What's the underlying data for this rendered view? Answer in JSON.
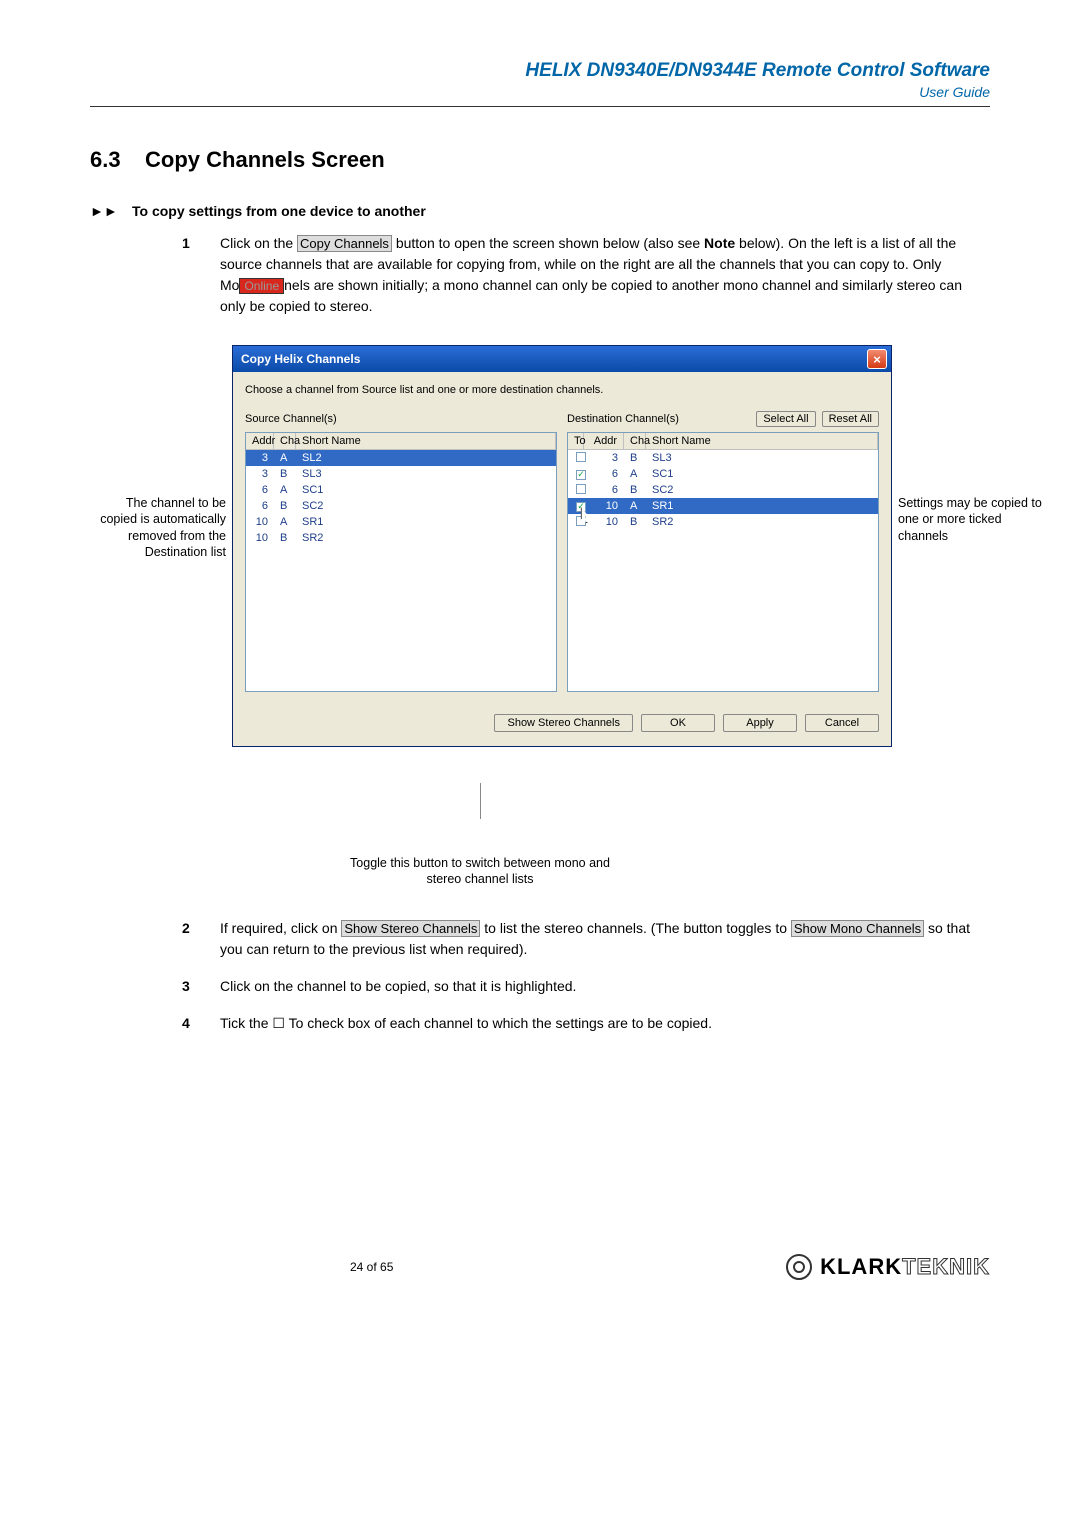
{
  "header": {
    "title": "HELIX DN9340E/DN9344E Remote Control Software",
    "subtitle": "User Guide"
  },
  "section": {
    "number": "6.3",
    "title": "Copy Channels Screen"
  },
  "instruction": {
    "heading": "To copy settings from one device to another"
  },
  "steps": {
    "s1": {
      "num": "1",
      "t1": "Click on the ",
      "btn1": "Copy Channels",
      "t2": " button to open the screen shown below (also see ",
      "bold1": "Note",
      "t3": " below). On the left is a list of all the source channels that are available for copying from, while on the right are all the channels that you can copy to.  Only Mo",
      "online": "Online",
      "t4": "nels are shown initially; a mono channel can only be copied to another mono channel and similarly stereo can only be copied to stereo."
    },
    "s2": {
      "num": "2",
      "t1": "If required, click on ",
      "btn1": "Show Stereo Channels",
      "t2": " to list the stereo channels.  (The button toggles to ",
      "btn2": "Show Mono Channels",
      "t3": " so that you can return to the previous list when required)."
    },
    "s3": {
      "num": "3",
      "text": "Click on the channel to be copied, so that it is highlighted."
    },
    "s4": {
      "num": "4",
      "t1": "Tick the ",
      "cb": "☐ To",
      "t2": " check box of each channel to which the settings are to be copied."
    }
  },
  "annot_left": "The channel to be copied is automatically removed from the Destination list",
  "annot_right": "Settings may be copied to one or more ticked channels",
  "annot_below": "Toggle this button to switch between mono and stereo channel lists",
  "dialog": {
    "title": "Copy Helix Channels",
    "hint": "Choose a channel from Source list and one or more destination channels.",
    "src_label": "Source Channel(s)",
    "dst_label": "Destination Channel(s)",
    "select_all": "Select All",
    "reset_all": "Reset All",
    "src_head": {
      "addr": "Addr",
      "cha": "Cha",
      "short": "Short Name"
    },
    "dst_head": {
      "to": "To",
      "addr": "Addr",
      "cha": "Cha",
      "short": "Short Name"
    },
    "src_rows": [
      {
        "addr": "3",
        "cha": "A",
        "short": "SL2",
        "sel": true
      },
      {
        "addr": "3",
        "cha": "B",
        "short": "SL3"
      },
      {
        "addr": "6",
        "cha": "A",
        "short": "SC1"
      },
      {
        "addr": "6",
        "cha": "B",
        "short": "SC2"
      },
      {
        "addr": "10",
        "cha": "A",
        "short": "SR1"
      },
      {
        "addr": "10",
        "cha": "B",
        "short": "SR2"
      }
    ],
    "dst_rows": [
      {
        "addr": "3",
        "cha": "B",
        "short": "SL3",
        "chk": false
      },
      {
        "addr": "6",
        "cha": "A",
        "short": "SC1",
        "chk": true
      },
      {
        "addr": "6",
        "cha": "B",
        "short": "SC2",
        "chk": false
      },
      {
        "addr": "10",
        "cha": "A",
        "short": "SR1",
        "chk": true,
        "sel": true
      },
      {
        "addr": "10",
        "cha": "B",
        "short": "SR2",
        "chk": false
      }
    ],
    "btn_stereo": "Show Stereo Channels",
    "btn_ok": "OK",
    "btn_apply": "Apply",
    "btn_cancel": "Cancel"
  },
  "footer": {
    "page": "24 of 65",
    "brand1": "KLARK",
    "brand2": "TEKNIK"
  }
}
